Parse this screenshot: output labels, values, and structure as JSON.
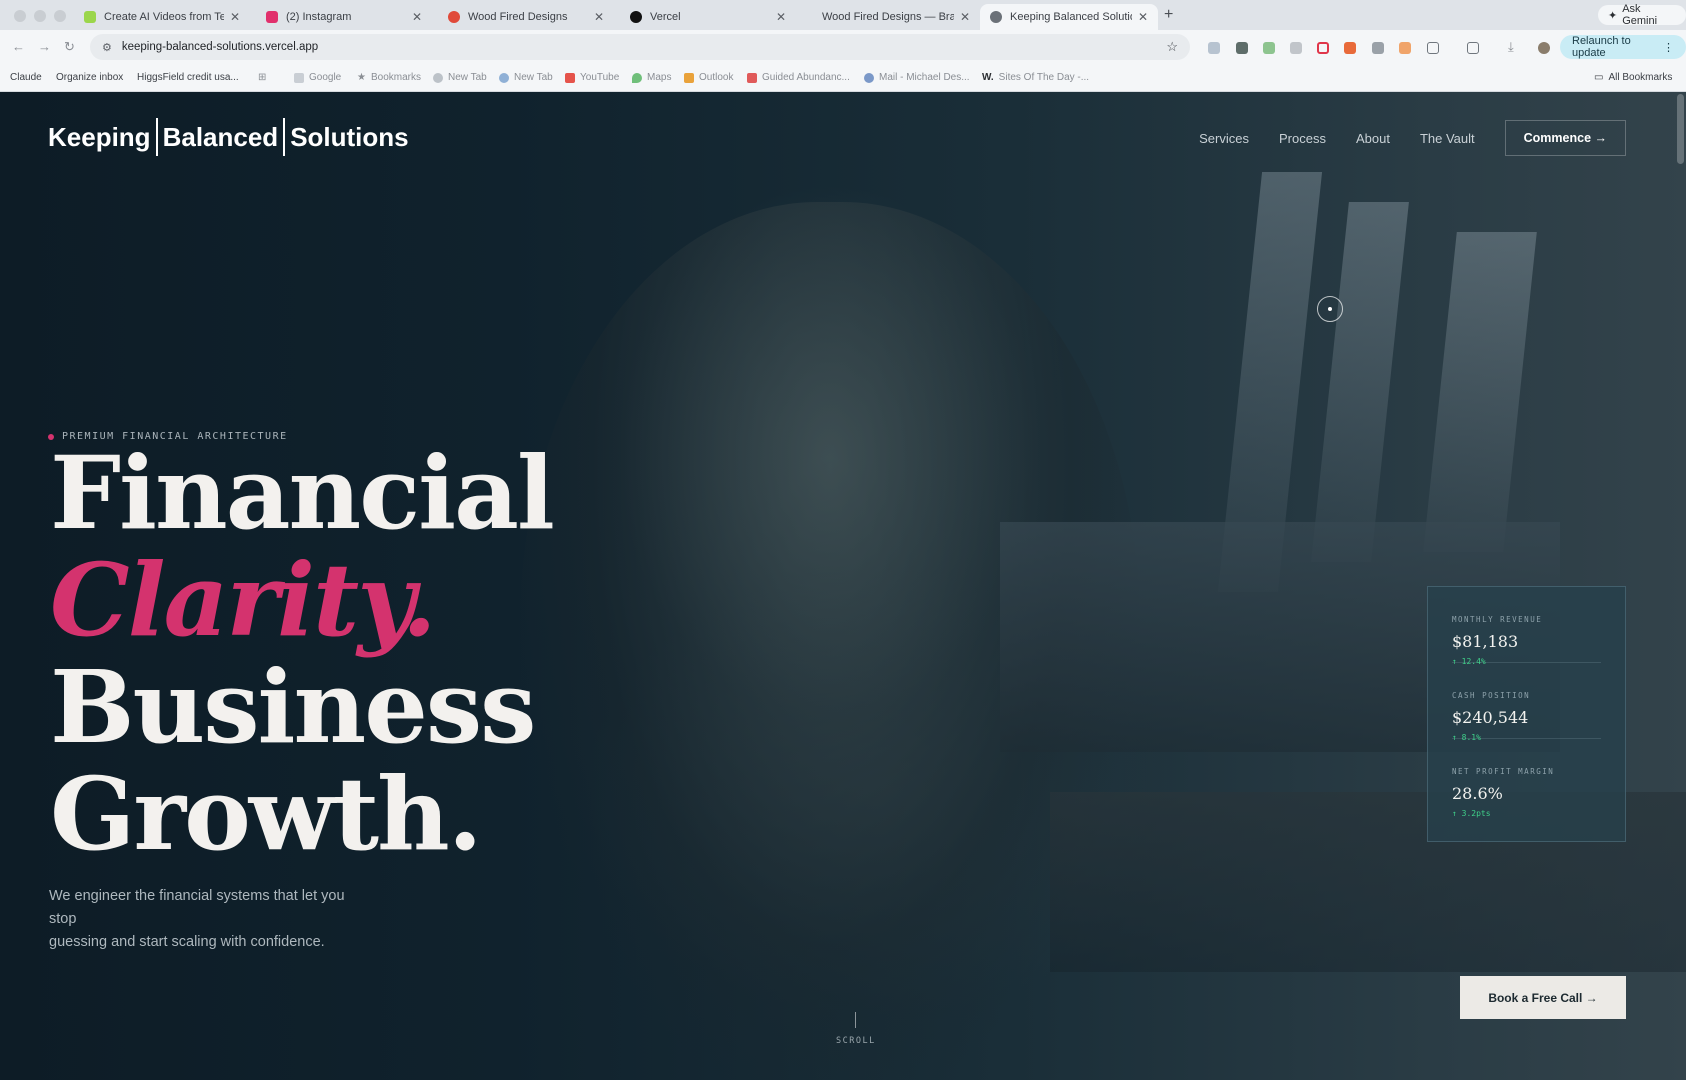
{
  "browser": {
    "tabs": [
      {
        "title": "Create AI Videos from Text &",
        "favicon_color": "#9bd64b"
      },
      {
        "title": "(2) Instagram",
        "favicon_color": "#e1306c"
      },
      {
        "title": "Wood Fired Designs",
        "favicon_color": "#e04a3a"
      },
      {
        "title": "Vercel",
        "favicon_color": "#111111"
      },
      {
        "title": "Wood Fired Designs — Brand",
        "favicon_color": "#d9dde2"
      },
      {
        "title": "Keeping Balanced Solutions |",
        "favicon_color": "#6b7178"
      }
    ],
    "active_tab": 5,
    "new_tab": "+",
    "ask_gemini": "Ask Gemini",
    "url": "keeping-balanced-solutions.vercel.app",
    "relaunch": "Relaunch to update",
    "bookmarks": [
      "Claude",
      "Organize inbox",
      "HiggsField credit usa...",
      "Google",
      "Bookmarks",
      "New Tab",
      "New Tab",
      "YouTube",
      "Maps",
      "Outlook",
      "Guided Abundanc...",
      "Mail - Michael Des...",
      "Sites Of The Day -..."
    ],
    "all_bookmarks": "All Bookmarks"
  },
  "site": {
    "logo": {
      "part1": "Keeping",
      "part2": "Balanced",
      "part3": "Solutions"
    },
    "nav": {
      "services": "Services",
      "process": "Process",
      "about": "About",
      "vault": "The Vault",
      "cta": "Commence →"
    },
    "eyebrow": "PREMIUM FINANCIAL ARCHITECTURE",
    "headline": {
      "line1": "Financial",
      "line2": "Clarity.",
      "line3": "Business",
      "line4": "Growth."
    },
    "subcopy": {
      "line1": "We engineer the financial systems that let you",
      "line2": "stop",
      "line3": "guessing and start scaling with confidence."
    },
    "metrics": [
      {
        "label": "MONTHLY REVENUE",
        "value": "$81,183",
        "change": "↑ 12.4%"
      },
      {
        "label": "CASH POSITION",
        "value": "$240,544",
        "change": "↑ 8.1%"
      },
      {
        "label": "NET PROFIT MARGIN",
        "value": "28.6%",
        "change": "↑ 3.2pts"
      }
    ],
    "book_call": "Book a Free Call →",
    "scroll": "SCROLL",
    "colors": {
      "accent": "#d4336e",
      "positive": "#3fd08a",
      "background": "#0e1f29"
    }
  }
}
